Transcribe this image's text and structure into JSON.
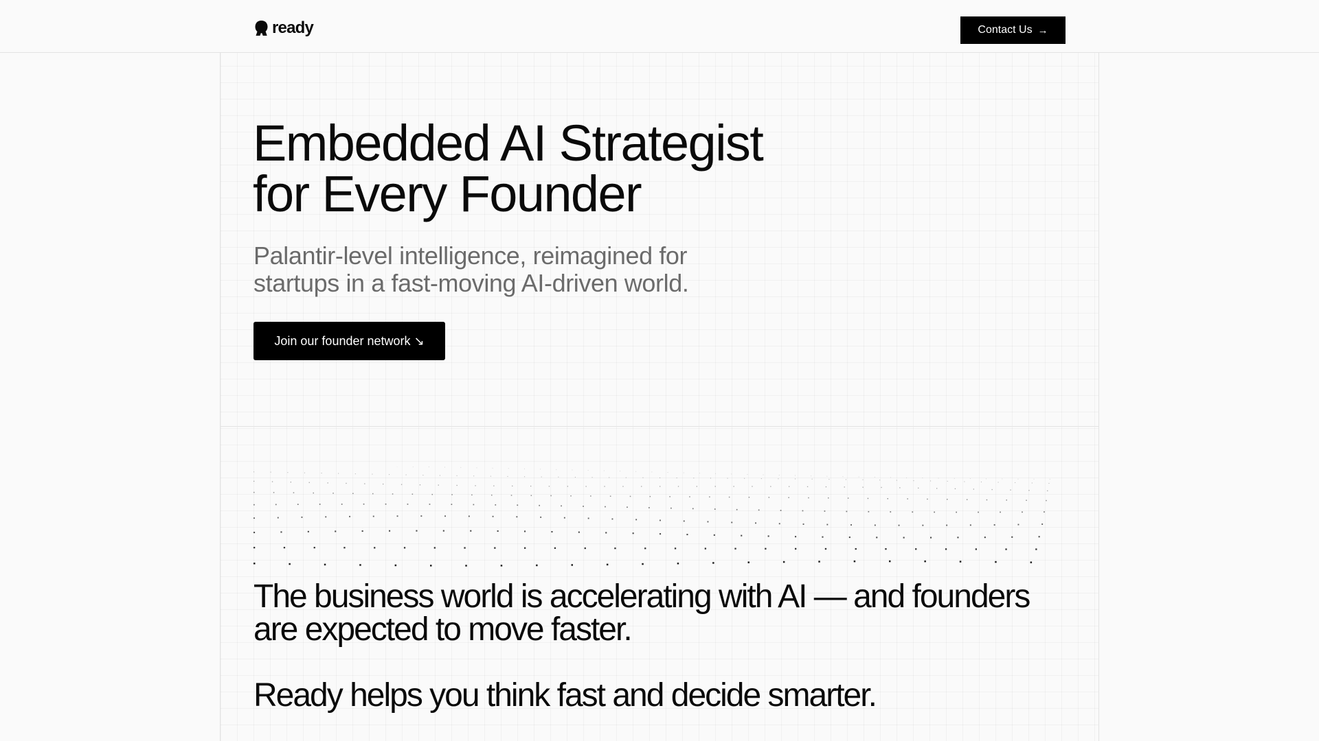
{
  "header": {
    "logo_text": "ready",
    "contact_label": "Contact Us",
    "contact_icon": "arrow-right-icon"
  },
  "hero": {
    "title_line1": "Embedded AI Strategist",
    "title_line2": "for Every Founder",
    "subtitle_line1": "Palantir-level intelligence, reimagined for",
    "subtitle_line2": "startups in a fast-moving AI-driven world.",
    "cta_label": "Join our founder network ↘"
  },
  "statement": {
    "line1": "The business world is accelerating with AI — and founders",
    "line2": "are expected to move faster.",
    "line3": "Ready helps you think fast and decide smarter."
  },
  "colors": {
    "background": "#fafafa",
    "text": "#0a0a0a",
    "muted": "#6b6b6b",
    "button": "#000000",
    "border": "#e3e3e3"
  }
}
